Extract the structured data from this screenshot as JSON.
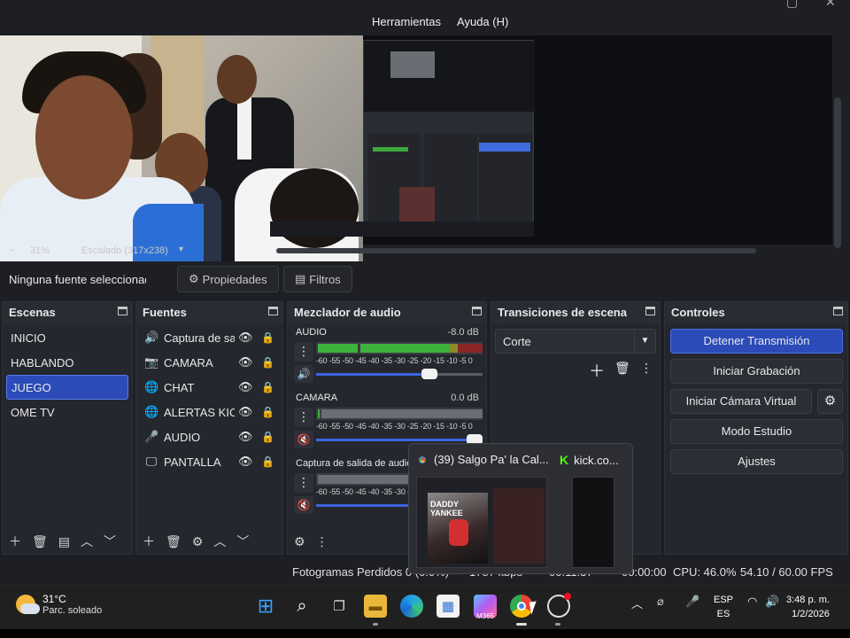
{
  "menu": {
    "tools": "Herramientas",
    "help": "Ayuda (H)"
  },
  "preview": {
    "zoom_minus": "−",
    "zoom": "31%",
    "scale": "Escalado (317x238)",
    "dropdown": "▾"
  },
  "props": {
    "no_selection": "Ninguna fuente seleccionada",
    "properties": "Propiedades",
    "filters": "Filtros"
  },
  "scenes": {
    "title": "Escenas",
    "items": [
      "INICIO",
      "HABLANDO",
      "JUEGO",
      "OME TV"
    ],
    "selected": "JUEGO"
  },
  "sources": {
    "title": "Fuentes",
    "items": [
      {
        "label": "Captura de salida",
        "icon": "speaker-icon"
      },
      {
        "label": "CAMARA",
        "icon": "camera-icon"
      },
      {
        "label": "CHAT",
        "icon": "globe-icon"
      },
      {
        "label": "ALERTAS KICK",
        "icon": "globe-icon"
      },
      {
        "label": "AUDIO",
        "icon": "microphone-icon"
      },
      {
        "label": "PANTALLA",
        "icon": "monitor-icon"
      }
    ]
  },
  "mixer": {
    "title": "Mezclador de audio",
    "ticks": "-60 -55 -50 -45 -40 -35 -30 -25 -20 -15 -10  -5   0",
    "channels": [
      {
        "name": "AUDIO",
        "db": "-8.0 dB",
        "volume": 0.68,
        "muted": false
      },
      {
        "name": "CAMARA",
        "db": "0.0 dB",
        "volume": 1.0,
        "muted": true
      },
      {
        "name": "Captura de salida de audio",
        "db": "",
        "volume": 0.6,
        "muted": true
      }
    ]
  },
  "transitions": {
    "title": "Transiciones de escena",
    "selected": "Corte"
  },
  "controls": {
    "title": "Controles",
    "stop_stream": "Detener Transmisión",
    "start_recording": "Iniciar Grabación",
    "virtual_cam": "Iniciar Cámara Virtual",
    "studio_mode": "Modo Estudio",
    "settings": "Ajustes"
  },
  "status": {
    "dropped": "Fotogramas Perdidos 0 (0.0%)",
    "bitrate": "1787 kbps",
    "stream_time": "00:11:37",
    "rec_time": "00:00:00",
    "cpu": "CPU: 46.0%",
    "fps": "54.10 / 60.00 FPS"
  },
  "popup": {
    "tab1": "(39) Salgo Pa' la Cal...",
    "tab2": "kick.co...",
    "album_text": "DADDY YANKEE"
  },
  "taskbar": {
    "temp": "31°C",
    "weather": "Parc. soleado",
    "lang1": "ESP",
    "lang2": "ES",
    "time": "3:48 p. m.",
    "date": "1/2/2026",
    "m365": "M365"
  },
  "colors": {
    "accent": "#2a4bb8",
    "meter_green": "#3db33d",
    "meter_yellow": "#c9a52a",
    "meter_red": "#a82a2a"
  }
}
